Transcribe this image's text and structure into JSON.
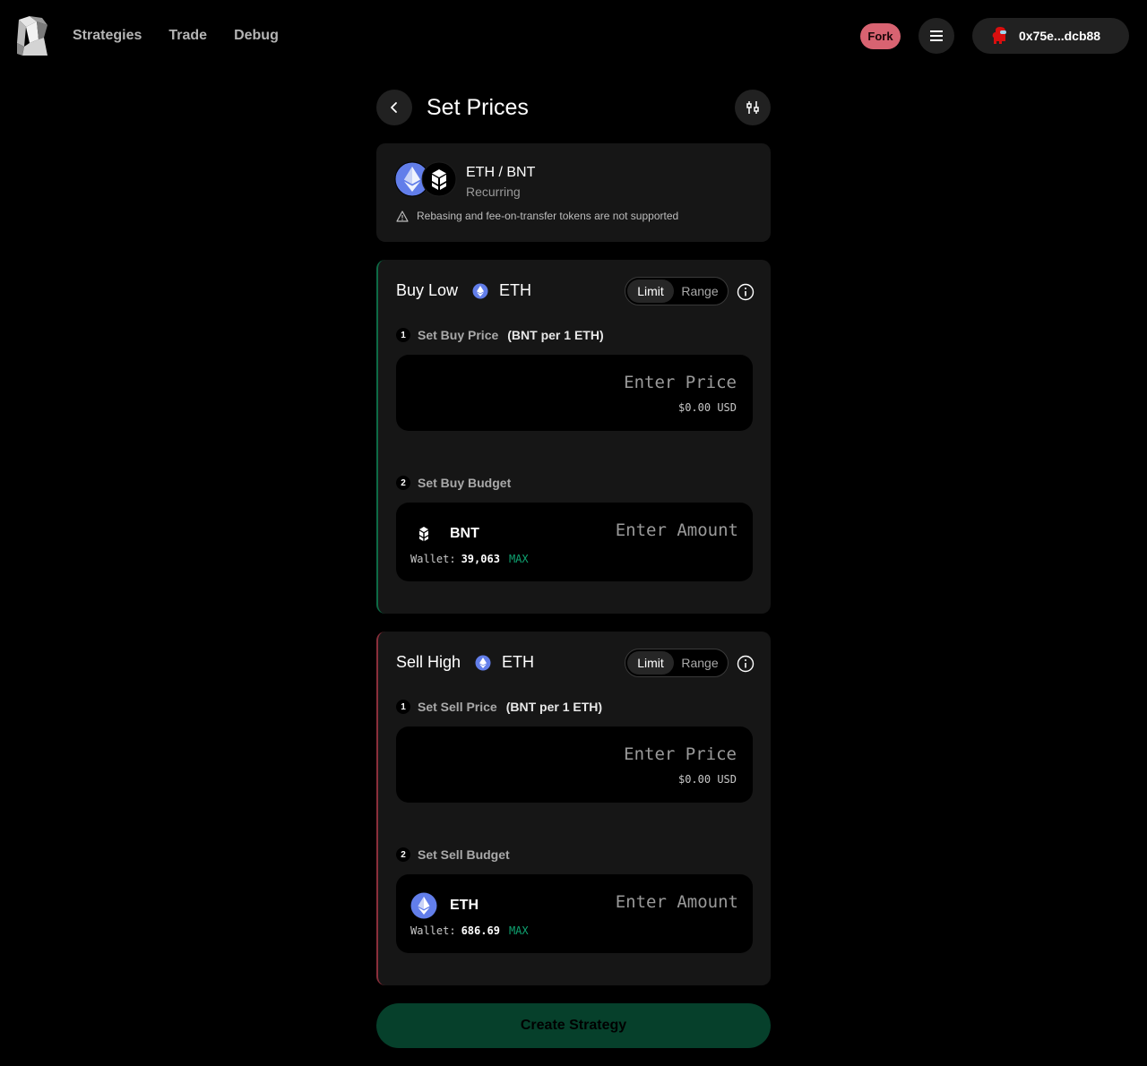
{
  "nav": {
    "items": [
      {
        "label": "Strategies"
      },
      {
        "label": "Trade"
      },
      {
        "label": "Debug"
      }
    ]
  },
  "header": {
    "network_badge": "Fork",
    "menu_icon": "hamburger-icon",
    "wallet_address": "0x75e...dcb88",
    "avatar_icon": "red-character-icon"
  },
  "page": {
    "title": "Set Prices",
    "back_icon": "chevron-left-icon",
    "settings_icon": "sliders-icon"
  },
  "pair": {
    "base": "ETH",
    "separator": "/",
    "quote": "BNT",
    "type": "Recurring",
    "warning": "Rebasing and fee-on-transfer tokens are not supported"
  },
  "buy": {
    "title": "Buy Low",
    "token": "ETH",
    "toggle": {
      "active": "Limit",
      "inactive": "Range"
    },
    "step1": {
      "number": "1",
      "label": "Set Buy Price",
      "unit": "(BNT per 1 ETH)"
    },
    "price_placeholder": "Enter Price",
    "price_usd": "$0.00 USD",
    "step2": {
      "number": "2",
      "label": "Set Buy Budget"
    },
    "budget_token": "BNT",
    "budget_placeholder": "Enter Amount",
    "wallet_label": "Wallet:",
    "wallet_value": "39,063",
    "max_label": "MAX"
  },
  "sell": {
    "title": "Sell High",
    "token": "ETH",
    "toggle": {
      "active": "Limit",
      "inactive": "Range"
    },
    "step1": {
      "number": "1",
      "label": "Set Sell Price",
      "unit": "(BNT per 1 ETH)"
    },
    "price_placeholder": "Enter Price",
    "price_usd": "$0.00 USD",
    "step2": {
      "number": "2",
      "label": "Set Sell Budget"
    },
    "budget_token": "ETH",
    "budget_placeholder": "Enter Amount",
    "wallet_label": "Wallet:",
    "wallet_value": "686.69",
    "max_label": "MAX"
  },
  "actions": {
    "create_label": "Create Strategy"
  },
  "colors": {
    "background": "#000000",
    "card": "#161616",
    "buy_accent": "#0e6a45",
    "sell_accent": "#8a2f3b",
    "max_green": "#0fa371",
    "fork_badge": "#d86371",
    "create_button": "#06402b",
    "eth_blue": "#627eea"
  }
}
